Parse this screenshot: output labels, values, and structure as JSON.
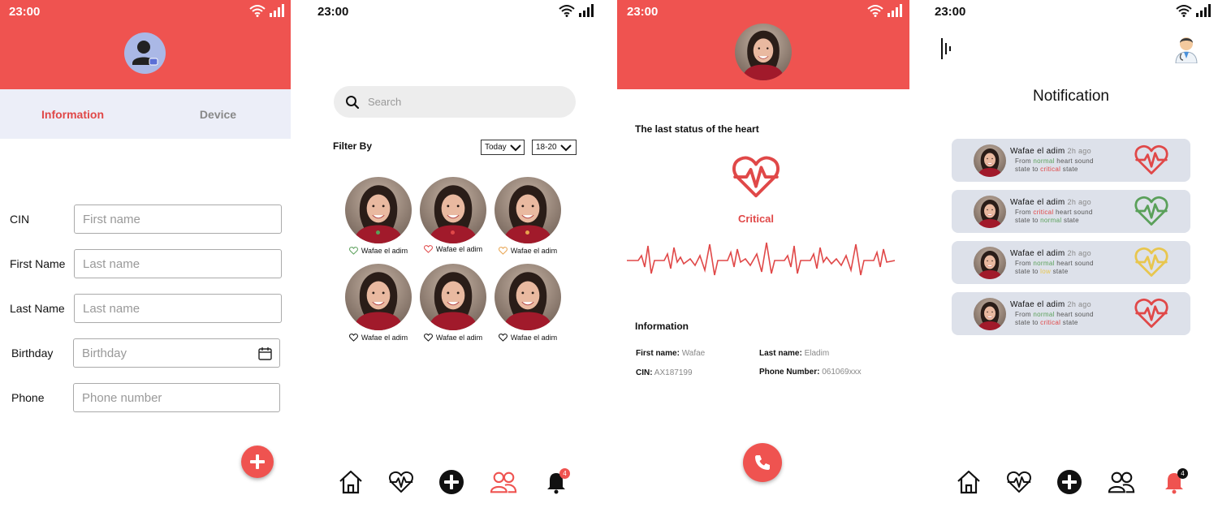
{
  "status_time": "23:00",
  "colors": {
    "accent": "#ef5350",
    "normal": "#5aa05a",
    "critical": "#e04848",
    "warning": "#e8c64e"
  },
  "screen1": {
    "tabs": [
      {
        "label": "Information"
      },
      {
        "label": "Device"
      }
    ],
    "fields": [
      {
        "label": "CIN",
        "placeholder": "First name"
      },
      {
        "label": "First Name",
        "placeholder": "Last name"
      },
      {
        "label": "Last Name",
        "placeholder": "Last name"
      },
      {
        "label": "Birthday",
        "placeholder": "Birthday"
      },
      {
        "label": "Phone",
        "placeholder": "Phone number"
      }
    ]
  },
  "screen2": {
    "search_placeholder": "Search",
    "filter_label": "Filter By",
    "filter_date": "Today",
    "filter_age": "18-20",
    "patients": [
      {
        "name": "Wafae el adim"
      },
      {
        "name": "Wafae el adim"
      },
      {
        "name": "Wafae el adim"
      },
      {
        "name": "Wafae el adim"
      },
      {
        "name": "Wafae el adim"
      },
      {
        "name": "Wafae el adim"
      }
    ],
    "nav_badge": "4"
  },
  "screen3": {
    "last_status_title": "The last status of the heart",
    "status": "Critical",
    "info_title": "Information",
    "first_name_label": "First name:",
    "first_name": "Wafae",
    "last_name_label": "Last name:",
    "last_name": "Eladim",
    "cin_label": "CIN:",
    "cin": "AX187199",
    "phone_label": "Phone Number:",
    "phone": "061069xxx"
  },
  "screen4": {
    "title": "Notification",
    "nav_badge": "4",
    "notifications": [
      {
        "name": "Wafae el adim",
        "ago": "2h ago",
        "from": "From",
        "from_state": "normal",
        "mid": "heart sound",
        "to": "state to",
        "to_state": "critical",
        "end": "state"
      },
      {
        "name": "Wafae el adim",
        "ago": "2h ago",
        "from": "From",
        "from_state": "critical",
        "mid": "heart sound",
        "to": "state to",
        "to_state": "normal",
        "end": "state"
      },
      {
        "name": "Wafae el adim",
        "ago": "2h ago",
        "from": "From",
        "from_state": "normal",
        "mid": "heart sound",
        "to": "state to",
        "to_state": "low",
        "end": "state"
      },
      {
        "name": "Wafae el adim",
        "ago": "2h ago",
        "from": "From",
        "from_state": "normal",
        "mid": "heart sound",
        "to": "state to",
        "to_state": "critical",
        "end": "state"
      }
    ]
  }
}
